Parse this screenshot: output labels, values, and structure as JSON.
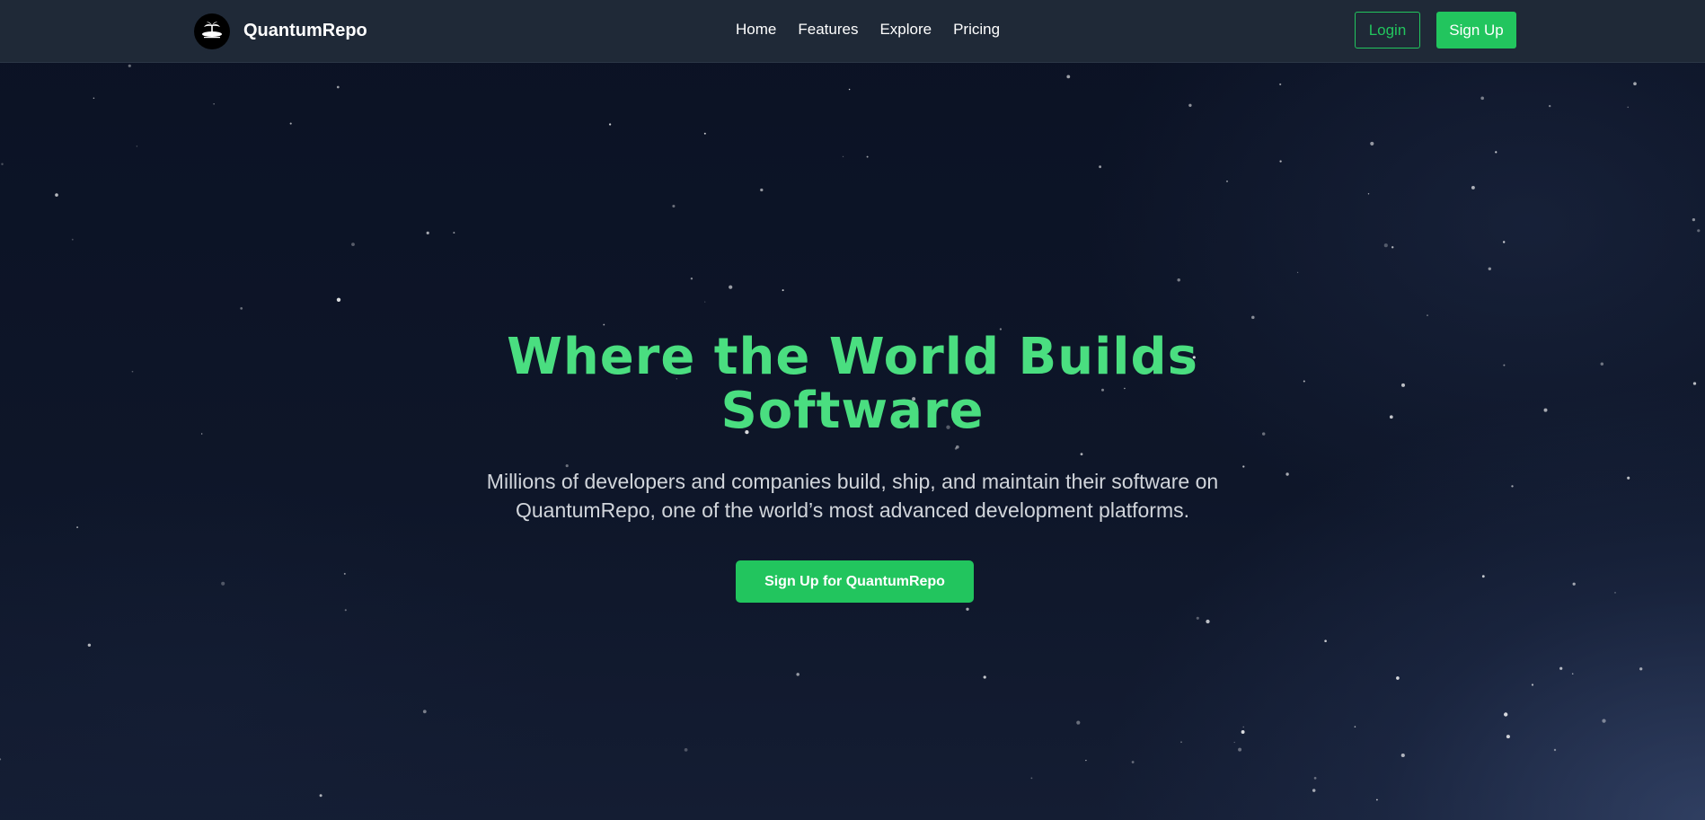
{
  "navbar": {
    "brand": "QuantumRepo",
    "logo_icon": "island-palm-icon",
    "links": [
      {
        "label": "Home"
      },
      {
        "label": "Features"
      },
      {
        "label": "Explore"
      },
      {
        "label": "Pricing"
      }
    ],
    "login_label": "Login",
    "signup_label": "Sign Up"
  },
  "hero": {
    "title": "Where the World Builds Software",
    "subtitle": "Millions of developers and companies build, ship, and maintain their software on QuantumRepo, one of the world’s most advanced development platforms.",
    "cta_label": "Sign Up for QuantumRepo"
  },
  "colors": {
    "accent": "#22c55e",
    "title_green": "#4ade80",
    "navbar_bg": "#1f2937",
    "hero_bg": "#0c1324"
  }
}
